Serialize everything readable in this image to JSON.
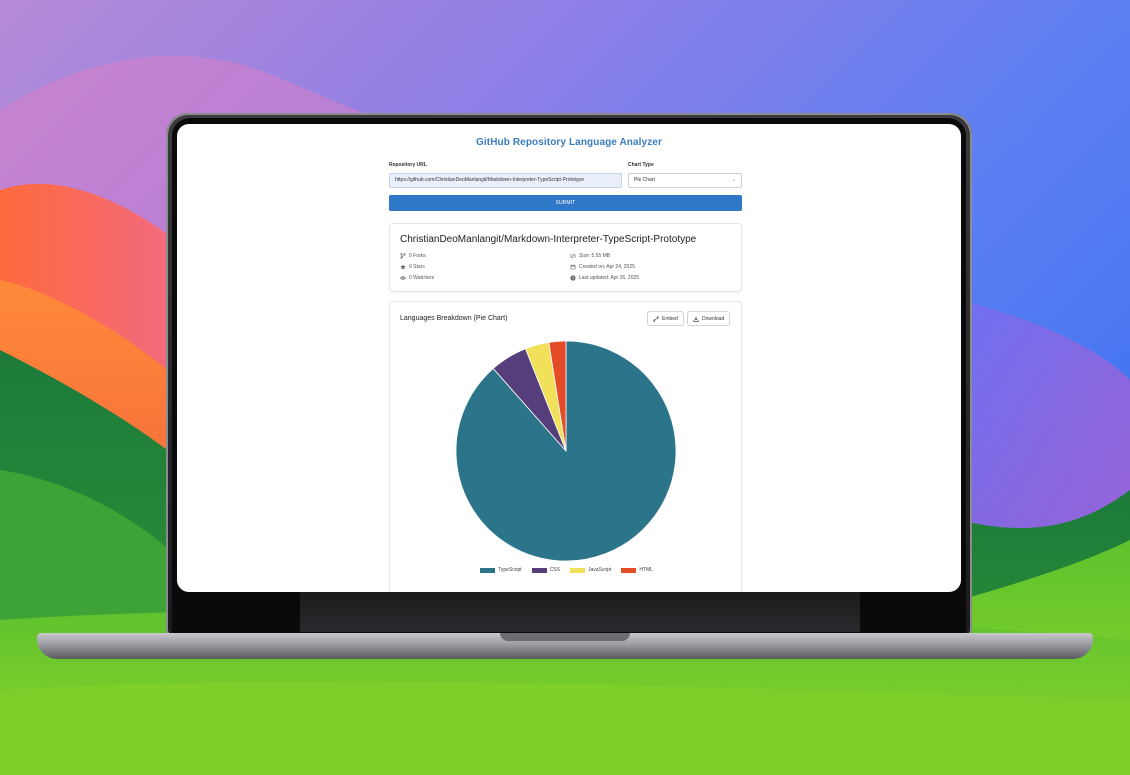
{
  "app": {
    "title": "GitHub Repository Language Analyzer"
  },
  "form": {
    "url_label": "Repository URL",
    "url_value": "https://github.com/ChristianDeoManlangit/Markdown-Interpreter-TypeScript-Prototype",
    "chart_type_label": "Chart Type",
    "chart_type_value": "Pie Chart",
    "submit_label": "SUBMIT"
  },
  "repo": {
    "name": "ChristianDeoManlangit/Markdown-Interpreter-TypeScript-Prototype",
    "forks": "0 Forks",
    "stars": "0 Stars",
    "watchers": "0 Watchers",
    "size": "Size: 5.55 MB",
    "created": "Created on: Apr 24, 2025",
    "updated": "Last updated: Apr 26, 2025"
  },
  "chart_card": {
    "title": "Languages Breakdown (Pie Chart)",
    "embed_label": "Embed",
    "download_label": "Download"
  },
  "chart_data": {
    "type": "pie",
    "categories": [
      "TypeScript",
      "CSS",
      "JavaScript",
      "HTML"
    ],
    "values": [
      88.5,
      5.5,
      3.5,
      2.5
    ],
    "colors": [
      "#2b7489",
      "#563d7c",
      "#f1e05a",
      "#e34c26"
    ],
    "legend_position": "bottom"
  }
}
